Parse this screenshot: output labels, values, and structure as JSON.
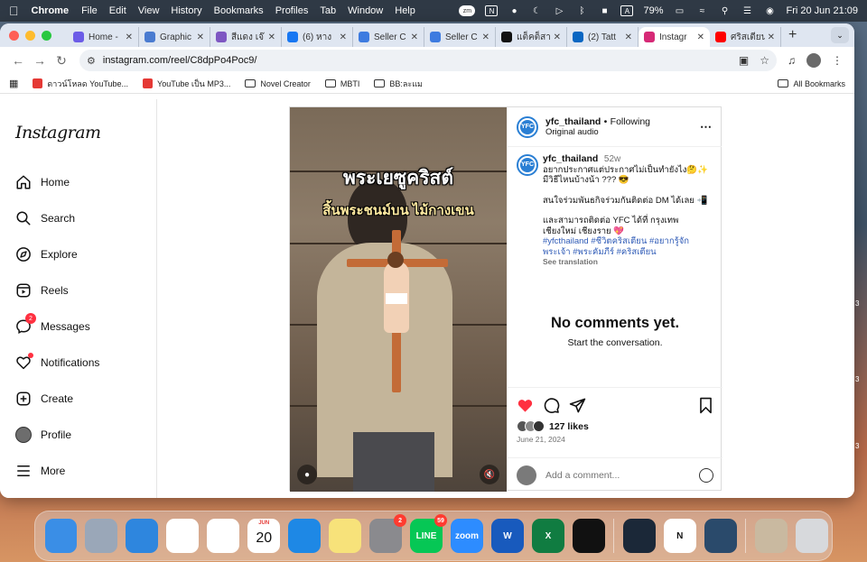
{
  "menubar": {
    "app": "Chrome",
    "items": [
      "File",
      "Edit",
      "View",
      "History",
      "Bookmarks",
      "Profiles",
      "Tab",
      "Window",
      "Help"
    ],
    "tray_zm": "zm",
    "tray_n": "N",
    "tray_a": "A",
    "battery": "79%",
    "datetime": "Fri 20 Jun  21:09"
  },
  "tabs": [
    {
      "title": "Home -",
      "color": "#6c5ce7",
      "icon": "home-tab-icon"
    },
    {
      "title": "Graphic",
      "color": "#4a7bd0",
      "icon": "graphic-tab-icon"
    },
    {
      "title": "สีแดง เจ๊",
      "color": "#7e57c2",
      "icon": "heart-tab-icon"
    },
    {
      "title": "(6) หาง",
      "color": "#1877f2",
      "icon": "facebook-icon"
    },
    {
      "title": "Seller C",
      "color": "#3d7be0",
      "icon": "seller-icon"
    },
    {
      "title": "Seller C",
      "color": "#3d7be0",
      "icon": "seller-icon"
    },
    {
      "title": "แต็คต็สา",
      "color": "#111111",
      "icon": "tiktok-icon"
    },
    {
      "title": "(2) Tatt",
      "color": "#0a66c2",
      "icon": "linkedin-icon"
    },
    {
      "title": "Instagr",
      "color": "#d62976",
      "icon": "instagram-icon",
      "active": true
    },
    {
      "title": "ศริสเตียน",
      "color": "#ff0000",
      "icon": "youtube-icon"
    }
  ],
  "toolbar": {
    "url": "instagram.com/reel/C8dpPo4Poc9/"
  },
  "bookmarks": [
    {
      "label": "ดาวน์โหลด YouTube...",
      "type": "site",
      "color": "#e53935"
    },
    {
      "label": "YouTube เป็น MP3...",
      "type": "site",
      "color": "#e53935"
    },
    {
      "label": "Novel Creator",
      "type": "folder"
    },
    {
      "label": "MBTI",
      "type": "folder"
    },
    {
      "label": "BB:ละแม",
      "type": "folder"
    }
  ],
  "all_bookmarks": "All Bookmarks",
  "instagram": {
    "logo": "Instagram",
    "nav": [
      {
        "label": "Home",
        "icon": "home-icon"
      },
      {
        "label": "Search",
        "icon": "search-icon"
      },
      {
        "label": "Explore",
        "icon": "explore-icon"
      },
      {
        "label": "Reels",
        "icon": "reels-icon"
      },
      {
        "label": "Messages",
        "icon": "messages-icon",
        "badge": "2"
      },
      {
        "label": "Notifications",
        "icon": "heart-icon",
        "dot": true
      },
      {
        "label": "Create",
        "icon": "create-icon"
      },
      {
        "label": "Profile",
        "icon": "profile-avatar"
      },
      {
        "label": "More",
        "icon": "menu-icon"
      }
    ],
    "video": {
      "caption_line1": "พระเยซูคริสต์",
      "caption_line2": "สิ้นพระชนม์บน ไม้กางเขน"
    },
    "post": {
      "username": "yfc_thailand",
      "separator": "•",
      "follow_label": "Following",
      "audio": "Original audio",
      "avatar_text": "YFC",
      "time_ago": "52w",
      "caption_lines": [
        "อยากประกาศแต่ประกาศไม่เป็นทำยังไง🤔✨",
        "มีวิธีไหนบ้างน้า ??? 😎",
        "",
        "สนใจร่วมพันธกิจร่วมกันติดต่อ DM ได้เลย 📲",
        "",
        "และสามารถติดต่อ YFC ได้ที่ กรุงเทพ",
        "เชียงใหม่ เชียงราย 💖"
      ],
      "hashtags_line1": "#yfcthailand #ชีวิตคริสเตียน #อยากรู้จัก",
      "hashtags_line2": "พระเจ้า #พระคัมภีร์ #คริสเตียน",
      "see_translation": "See translation",
      "no_comments": "No comments yet.",
      "start_conversation": "Start the conversation.",
      "likes": "127 likes",
      "date": "June 21, 2024",
      "comment_placeholder": "Add a comment..."
    }
  },
  "dock": [
    {
      "name": "Finder",
      "color": "#3a8ee6"
    },
    {
      "name": "Launchpad",
      "color": "#9aa7b8"
    },
    {
      "name": "Safari",
      "color": "#2e86de"
    },
    {
      "name": "Chrome",
      "color": "#ffffff"
    },
    {
      "name": "Photos",
      "color": "#ffffff"
    },
    {
      "name": "Calendar",
      "color": "#ffffff",
      "label": "20",
      "month": "JUN"
    },
    {
      "name": "App Store",
      "color": "#1e88e5"
    },
    {
      "name": "Notes",
      "color": "#f7e27a"
    },
    {
      "name": "System Settings",
      "color": "#8a8a8e",
      "badge": "2"
    },
    {
      "name": "LINE",
      "color": "#06c755",
      "label": "LINE",
      "badge": "59"
    },
    {
      "name": "Zoom",
      "color": "#2d8cff",
      "label": "zoom"
    },
    {
      "name": "Word",
      "color": "#185abd",
      "label": "W"
    },
    {
      "name": "Excel",
      "color": "#107c41",
      "label": "X"
    },
    {
      "name": "CapCut",
      "color": "#111111"
    },
    {
      "name": "Steam",
      "color": "#1b2838"
    },
    {
      "name": "Notion",
      "color": "#ffffff",
      "label": "N"
    },
    {
      "name": "QuickTime",
      "color": "#2a4a6b"
    },
    {
      "name": "Downloads",
      "color": "#c9b9a0"
    },
    {
      "name": "Trash",
      "color": "#d7d9dc"
    }
  ]
}
